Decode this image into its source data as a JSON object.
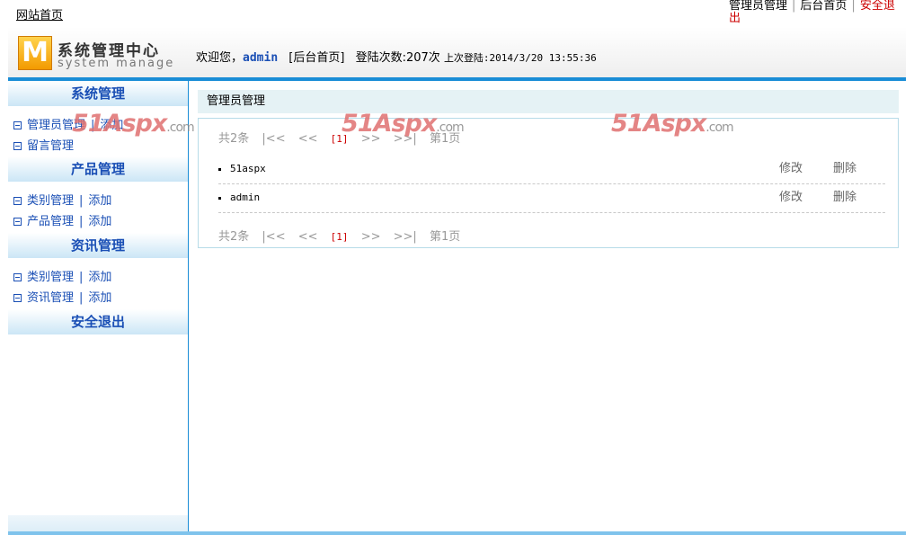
{
  "topbar": {
    "home_link": "网站首页",
    "links": [
      "管理员管理",
      "后台首页",
      "安全退出"
    ],
    "separator": "|"
  },
  "header": {
    "logo_letter": "M",
    "logo_cn": "系统管理中心",
    "logo_en": "system manage",
    "welcome_prefix": "欢迎您，",
    "username": "admin",
    "backend_link": "[后台首页]",
    "login_count": "登陆次数:207次",
    "last_login": "上次登陆:2014/3/20 13:55:36"
  },
  "sidebar": {
    "sections": [
      {
        "title": "系统管理",
        "items": [
          {
            "label": "管理员管理",
            "add": "添加"
          },
          {
            "label": "留言管理"
          }
        ]
      },
      {
        "title": "产品管理",
        "items": [
          {
            "label": "类别管理",
            "add": "添加"
          },
          {
            "label": "产品管理",
            "add": "添加"
          }
        ]
      },
      {
        "title": "资讯管理",
        "items": [
          {
            "label": "类别管理",
            "add": "添加"
          },
          {
            "label": "资讯管理",
            "add": "添加"
          }
        ]
      },
      {
        "title": "安全退出",
        "items": []
      }
    ],
    "separator": "|"
  },
  "main": {
    "title": "管理员管理",
    "pager": {
      "total": "共2条",
      "first": "|<<",
      "prev": "<<",
      "current": "[1]",
      "next": ">>",
      "last": ">>|",
      "page": "第1页"
    },
    "rows": [
      {
        "name": "51aspx",
        "edit": "修改",
        "delete": "删除"
      },
      {
        "name": "admin",
        "edit": "修改",
        "delete": "删除"
      }
    ]
  },
  "watermark": {
    "text": "51Aspx",
    "suffix": ".com"
  },
  "colors": {
    "accent": "#1a8dd6",
    "link": "#1a4fb5",
    "logout": "#cc0000",
    "current_page": "#cc0000"
  }
}
